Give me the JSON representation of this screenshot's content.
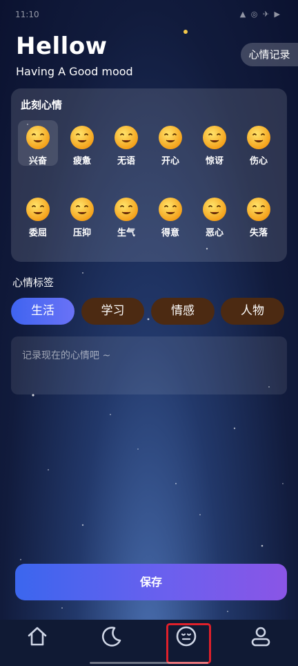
{
  "status_bar": {
    "time": "11:10",
    "icons": "▲ ◎ ✈ ▶"
  },
  "header": {
    "title": "Hellow",
    "subtitle": "Having A Good mood",
    "record_button": "心情记录"
  },
  "mood_card": {
    "title": "此刻心情",
    "moods": [
      {
        "label": "兴奋",
        "icon": "excited-emoji-icon",
        "selected": true
      },
      {
        "label": "疲惫",
        "icon": "tired-emoji-icon",
        "selected": false
      },
      {
        "label": "无语",
        "icon": "speechless-emoji-icon",
        "selected": false
      },
      {
        "label": "开心",
        "icon": "happy-emoji-icon",
        "selected": false
      },
      {
        "label": "惊讶",
        "icon": "surprised-emoji-icon",
        "selected": false
      },
      {
        "label": "伤心",
        "icon": "sad-emoji-icon",
        "selected": false
      },
      {
        "label": "委屈",
        "icon": "aggrieved-emoji-icon",
        "selected": false
      },
      {
        "label": "压抑",
        "icon": "depressed-emoji-icon",
        "selected": false
      },
      {
        "label": "生气",
        "icon": "angry-emoji-icon",
        "selected": false
      },
      {
        "label": "得意",
        "icon": "smug-emoji-icon",
        "selected": false
      },
      {
        "label": "恶心",
        "icon": "disgusted-emoji-icon",
        "selected": false
      },
      {
        "label": "失落",
        "icon": "disappointed-emoji-icon",
        "selected": false
      }
    ]
  },
  "tags_section": {
    "title": "心情标签",
    "tags": [
      {
        "label": "生活",
        "active": true
      },
      {
        "label": "学习",
        "active": false
      },
      {
        "label": "情感",
        "active": false
      },
      {
        "label": "人物",
        "active": false
      }
    ]
  },
  "note": {
    "placeholder": "记录现在的心情吧 ~",
    "value": ""
  },
  "save_button": "保存",
  "tab_bar": {
    "items": [
      "home-icon",
      "moon-icon",
      "mood-face-icon",
      "profile-icon"
    ],
    "active_index": 2
  },
  "colors": {
    "accent_blue": "#3f64f0",
    "tag_inactive": "#4c2a12",
    "emoji_yellow": "#f9c22c",
    "highlight": "#e0202a"
  }
}
